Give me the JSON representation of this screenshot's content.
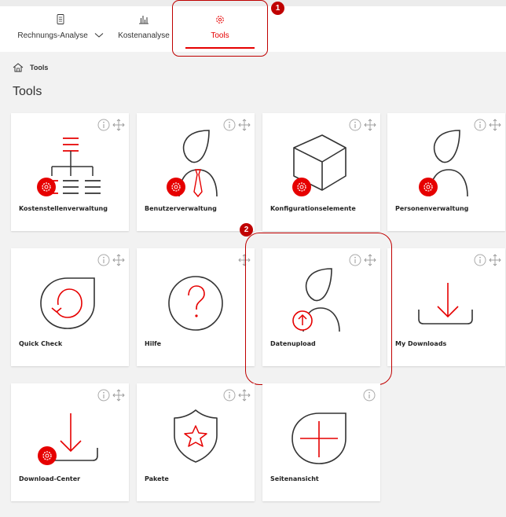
{
  "nav": {
    "items": [
      {
        "label": "Rechnungs-Analyse",
        "icon": "document-icon"
      },
      {
        "label": "Kostenanalyse",
        "icon": "bar-chart-icon"
      },
      {
        "label": "Tools",
        "icon": "gear-icon",
        "active": true
      }
    ]
  },
  "annotations": {
    "badge_1": "1",
    "badge_2": "2"
  },
  "breadcrumb": {
    "label": "Tools"
  },
  "page_title": "Tools",
  "tiles": [
    {
      "label": "Kostenstellenverwaltung",
      "icon": "cost-center-hierarchy-icon"
    },
    {
      "label": "Benutzerverwaltung",
      "icon": "user-management-icon"
    },
    {
      "label": "Konfigurationselemente",
      "icon": "configuration-box-icon"
    },
    {
      "label": "Personenverwaltung",
      "icon": "person-management-icon"
    },
    {
      "label": "Quick Check",
      "icon": "quick-check-icon"
    },
    {
      "label": "Hilfe",
      "icon": "help-question-icon"
    },
    {
      "label": "Datenupload",
      "icon": "data-upload-icon"
    },
    {
      "label": "My Downloads",
      "icon": "download-tray-icon"
    },
    {
      "label": "Download-Center",
      "icon": "download-center-icon"
    },
    {
      "label": "Pakete",
      "icon": "shield-star-icon"
    },
    {
      "label": "Seitenansicht",
      "icon": "page-view-plus-icon"
    }
  ],
  "colors": {
    "accent": "#e60000",
    "callout": "#c00000",
    "line": "#333333",
    "background": "#f2f2f2"
  }
}
